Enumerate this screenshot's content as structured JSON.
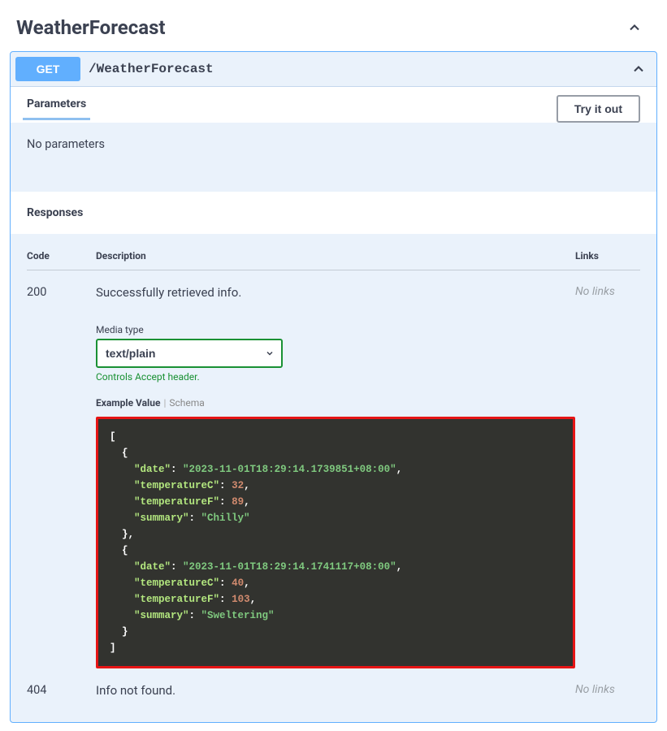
{
  "tag": {
    "title": "WeatherForecast"
  },
  "operation": {
    "method": "GET",
    "path": "/WeatherForecast"
  },
  "parameters": {
    "title": "Parameters",
    "empty_text": "No parameters",
    "try_label": "Try it out"
  },
  "responses": {
    "title": "Responses",
    "head": {
      "code": "Code",
      "description": "Description",
      "links": "Links"
    },
    "items": [
      {
        "code": "200",
        "description": "Successfully retrieved info.",
        "links": "No links",
        "media": {
          "label": "Media type",
          "selected": "text/plain",
          "note": "Controls Accept header."
        },
        "example_tabs": {
          "active": "Example Value",
          "other": "Schema"
        },
        "example_json": [
          {
            "date": "2023-11-01T18:29:14.1739851+08:00",
            "temperatureC": 32,
            "temperatureF": 89,
            "summary": "Chilly"
          },
          {
            "date": "2023-11-01T18:29:14.1741117+08:00",
            "temperatureC": 40,
            "temperatureF": 103,
            "summary": "Sweltering"
          }
        ]
      },
      {
        "code": "404",
        "description": "Info not found.",
        "links": "No links"
      }
    ]
  }
}
